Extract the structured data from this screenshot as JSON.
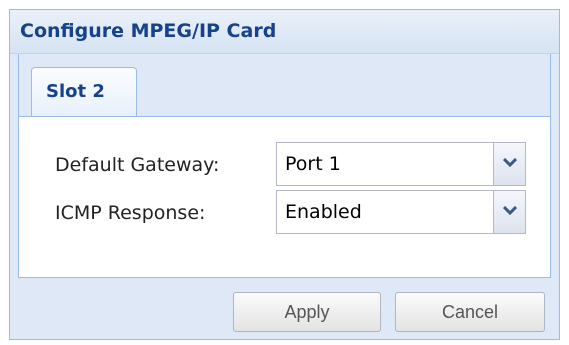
{
  "panel": {
    "title": "Configure MPEG/IP Card"
  },
  "tabs": [
    {
      "label": "Slot 2",
      "active": true
    }
  ],
  "form": {
    "fields": [
      {
        "label": "Default Gateway:",
        "value": "Port 1"
      },
      {
        "label": "ICMP Response:",
        "value": "Enabled"
      }
    ]
  },
  "buttons": {
    "apply": "Apply",
    "cancel": "Cancel"
  },
  "icons": {
    "dropdown": "chevron-down-icon"
  },
  "colors": {
    "title_text": "#15428b",
    "panel_border": "#99bbe8",
    "panel_background": "#dfe8f6"
  }
}
